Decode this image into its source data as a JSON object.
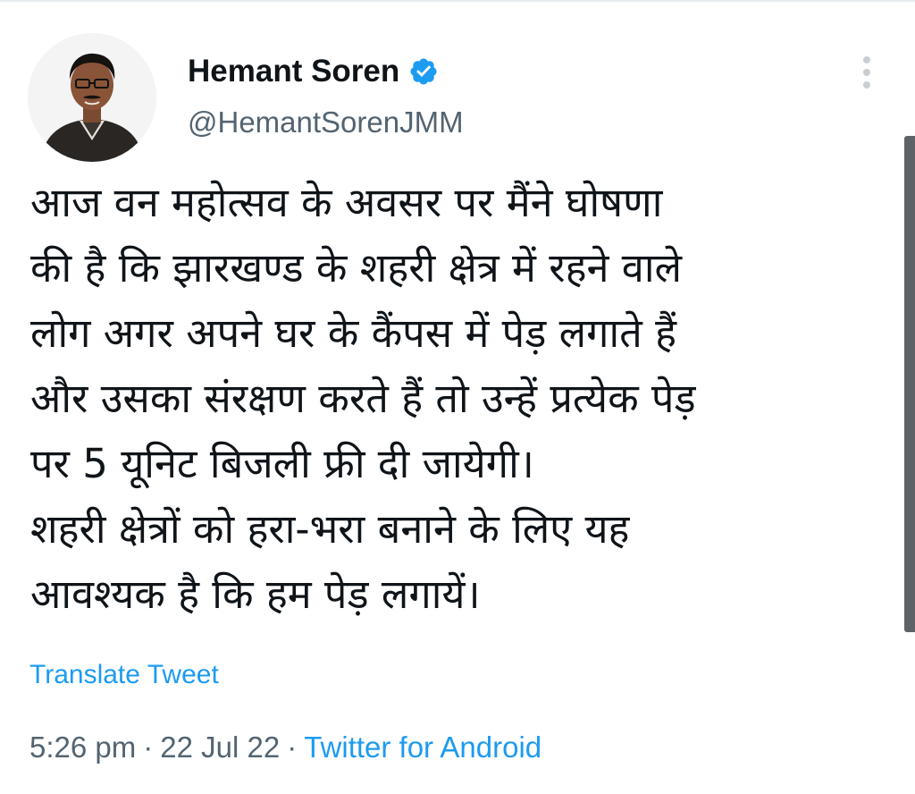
{
  "author": {
    "display_name": "Hemant Soren",
    "handle": "@HemantSorenJMM",
    "verified_icon": "verified-badge-icon",
    "verified_color": "#1d9bf0"
  },
  "tweet": {
    "lines": [
      "आज वन महोत्सव के अवसर पर मैंने घोषणा",
      "की है कि झारखण्ड के शहरी क्षेत्र में रहने वाले",
      "लोग अगर अपने घर के कैंपस में पेड़ लगाते हैं",
      "और उसका संरक्षण करते हैं तो उन्हें प्रत्येक पेड़",
      "पर 5 यूनिट बिजली फ्री दी जायेगी।",
      "शहरी क्षेत्रों को हरा-भरा बनाने के लिए यह",
      "आवश्यक है कि हम पेड़ लगायें।"
    ],
    "translate_label": "Translate Tweet"
  },
  "meta": {
    "time": "5:26 pm",
    "date": "22 Jul 22",
    "separator": "·",
    "source": "Twitter for Android"
  },
  "colors": {
    "link": "#1d9bf0",
    "secondary_text": "#536471",
    "primary_text": "#0f1419"
  }
}
